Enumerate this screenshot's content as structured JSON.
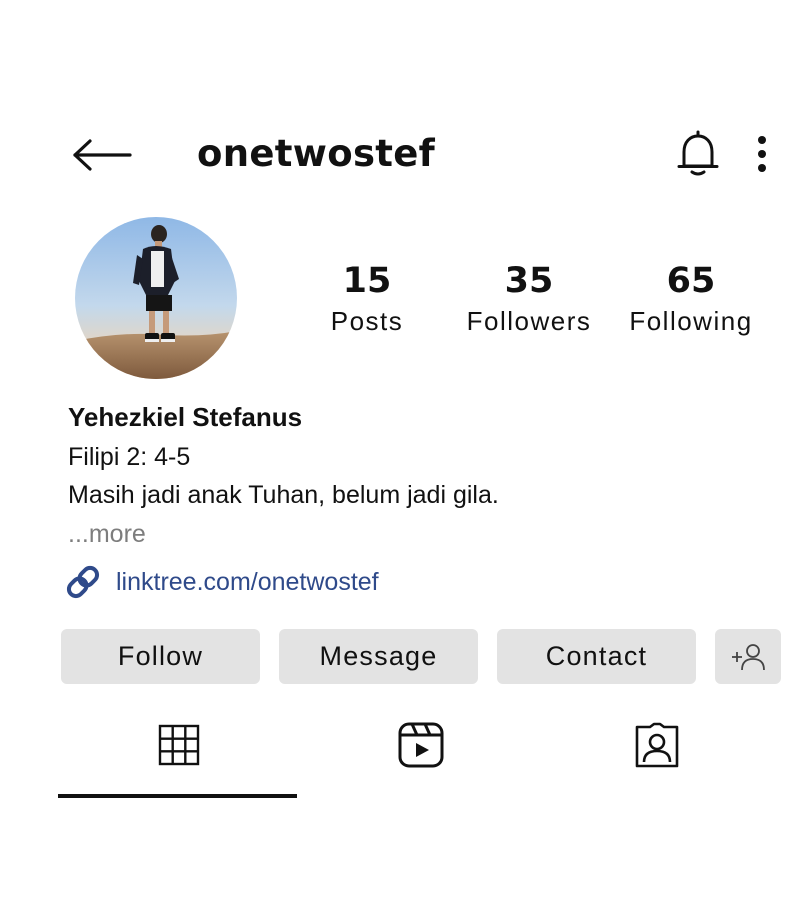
{
  "header": {
    "username": "onetwostef",
    "back_icon": "arrow-left-icon",
    "notification_icon": "bell-icon",
    "more_icon": "more-vertical-icon"
  },
  "profile": {
    "avatar_alt": "profile-photo",
    "stats": [
      {
        "value": "15",
        "label": "Posts"
      },
      {
        "value": "35",
        "label": "Followers"
      },
      {
        "value": "65",
        "label": "Following"
      }
    ],
    "full_name": "Yehezkiel Stefanus",
    "bio_lines": [
      "Filipi 2: 4-5",
      "Masih jadi anak Tuhan, belum jadi gila."
    ],
    "more_label": "...more",
    "link": {
      "icon": "link-icon",
      "text": "linktree.com/onetwostef"
    }
  },
  "actions": {
    "follow_label": "Follow",
    "message_label": "Message",
    "contact_label": "Contact",
    "add_user_icon": "add-user-icon"
  },
  "tabs": [
    {
      "icon": "grid-icon",
      "active": true
    },
    {
      "icon": "reels-icon",
      "active": false
    },
    {
      "icon": "tagged-icon",
      "active": false
    }
  ],
  "colors": {
    "link": "#2f4a8a",
    "button_bg": "#e3e3e3",
    "muted_text": "#7d7d7d"
  }
}
